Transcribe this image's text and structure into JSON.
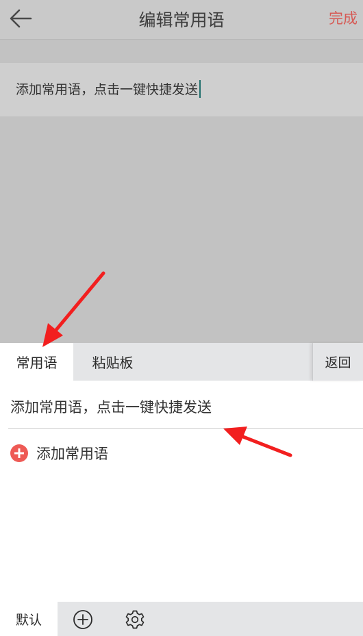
{
  "header": {
    "back_icon": "arrow-left-icon",
    "title": "编辑常用语",
    "done_label": "完成"
  },
  "editor": {
    "value": "添加常用语，点击一键快捷发送"
  },
  "panel": {
    "tabs": [
      {
        "label": "常用语",
        "active": true
      },
      {
        "label": "粘贴板",
        "active": false
      }
    ],
    "return_label": "返回",
    "phrases": [
      "添加常用语，点击一键快捷发送"
    ],
    "add_label": "添加常用语",
    "bottom": {
      "default_label": "默认",
      "icons": [
        "plus-circle-icon",
        "gear-icon"
      ]
    }
  },
  "colors": {
    "accent_red": "#d65a55",
    "add_icon_red": "#ee5a55",
    "annotation_arrow": "#f21f1f",
    "caret": "#1f6e6c"
  }
}
